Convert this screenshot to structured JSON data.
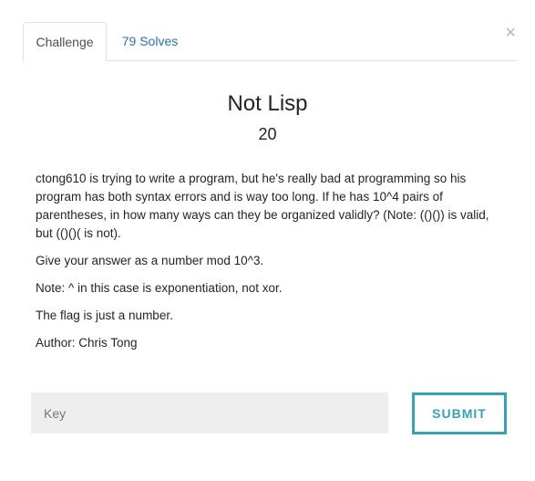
{
  "modal": {
    "close_symbol": "×",
    "tabs": [
      {
        "label": "Challenge",
        "active": true
      },
      {
        "label": "79 Solves",
        "active": false
      }
    ]
  },
  "challenge": {
    "name": "Not Lisp",
    "points": "20",
    "description": [
      "ctong610 is trying to write a program, but he's really bad at programming so his program has both syntax errors and is way too long. If he has 10^4 pairs of parentheses, in how many ways can they be organized validly? (Note: (()()) is valid, but (()()( is not).",
      "Give your answer as a number mod 10^3.",
      "Note: ^ in this case is exponentiation, not xor.",
      "The flag is just a number.",
      "Author: Chris Tong"
    ]
  },
  "submission": {
    "placeholder": "Key",
    "value": "",
    "submit_label": "SUBMIT"
  },
  "colors": {
    "accent": "#37a3b0",
    "link": "#2a72b5",
    "input_bg": "#eeeeee"
  }
}
